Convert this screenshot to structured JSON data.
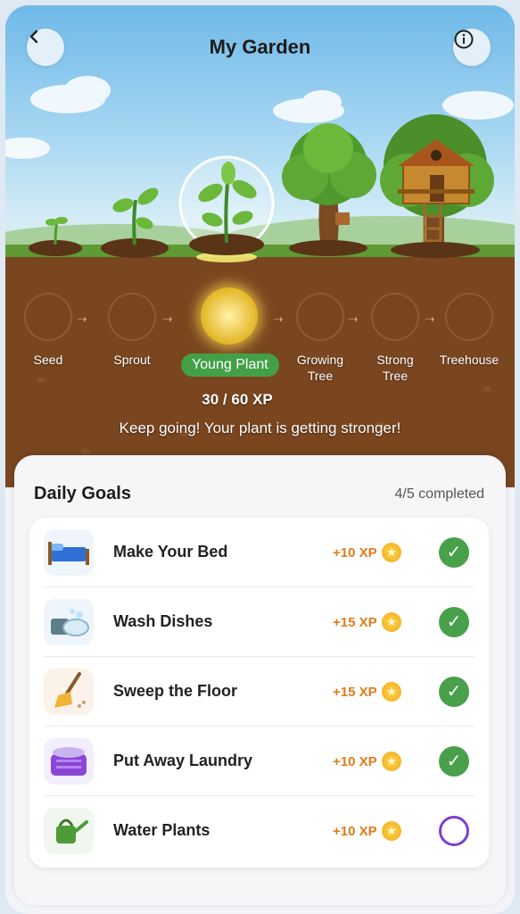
{
  "header": {
    "title": "My Garden",
    "back_icon": "chevron-left-icon",
    "info_icon": "info-icon"
  },
  "stages": [
    {
      "label": "Seed",
      "icon": "seed-icon",
      "active": false
    },
    {
      "label": "Sprout",
      "icon": "sprout-icon",
      "active": false
    },
    {
      "label": "Young Plant",
      "icon": "young-plant-icon",
      "active": true
    },
    {
      "label": "Growing\nTree",
      "icon": "growing-tree-icon",
      "active": false
    },
    {
      "label": "Strong\nTree",
      "icon": "strong-tree-icon",
      "active": false
    },
    {
      "label": "Treehouse",
      "icon": "treehouse-icon",
      "active": false
    }
  ],
  "progress": {
    "text": "30 / 60 XP",
    "current": 30,
    "max": 60
  },
  "message": "Keep going! Your plant is getting stronger!",
  "goals": {
    "title": "Daily Goals",
    "count": "4/5 completed",
    "items": [
      {
        "name": "Make Your Bed",
        "xp": "+10 XP",
        "icon": "bed-icon",
        "done": true
      },
      {
        "name": "Wash Dishes",
        "xp": "+15 XP",
        "icon": "dishes-icon",
        "done": true
      },
      {
        "name": "Sweep the Floor",
        "xp": "+15 XP",
        "icon": "broom-icon",
        "done": true
      },
      {
        "name": "Put Away Laundry",
        "xp": "+10 XP",
        "icon": "laundry-basket-icon",
        "done": true
      },
      {
        "name": "Water Plants",
        "xp": "+10 XP",
        "icon": "watering-can-icon",
        "done": false
      }
    ]
  },
  "colors": {
    "accent_green": "#43a047",
    "xp_orange": "#e07b18",
    "pending_purple": "#7b3fcf"
  }
}
